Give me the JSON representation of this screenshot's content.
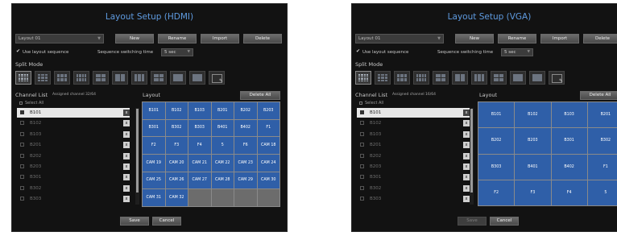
{
  "hdmi": {
    "title": "Layout Setup (HDMI)",
    "layout_select": "Layout 01",
    "buttons": {
      "new": "New",
      "rename": "Rename",
      "import": "Import",
      "delete": "Delete"
    },
    "use_sequence_label": "Use layout sequence",
    "switching_time_label": "Sequence switching time",
    "switching_time_value": "5 sec",
    "split_mode_label": "Split Mode",
    "channel_list_label": "Channel List",
    "assigned_label": "Assigned channel",
    "assigned_count": "32/64",
    "select_all_label": "Select All",
    "layout_label": "Layout",
    "delete_all": "Delete All",
    "channels": [
      "B101",
      "B102",
      "B103",
      "B201",
      "B202",
      "B203",
      "B301",
      "B302",
      "B303"
    ],
    "selected_channel_index": 0,
    "remove_glyph": "x",
    "scroll_position": 0.05,
    "grid": [
      "B101",
      "B102",
      "B103",
      "B201",
      "B202",
      "B203",
      "B301",
      "B302",
      "B303",
      "B401",
      "B402",
      "F1",
      "F2",
      "F3",
      "F4",
      "5",
      "F6",
      "CAM 18",
      "CAM 19",
      "CAM 20",
      "CAM 21",
      "CAM 22",
      "CAM 23",
      "CAM 24",
      "CAM 25",
      "CAM 26",
      "CAM 27",
      "CAM 28",
      "CAM 29",
      "CAM 30",
      "CAM 31",
      "CAM 32",
      "",
      "",
      "",
      ""
    ],
    "save": "Save",
    "cancel": "Cancel"
  },
  "vga": {
    "title": "Layout Setup (VGA)",
    "layout_select": "Layout 01",
    "buttons": {
      "new": "New",
      "rename": "Rename",
      "import": "Import",
      "delete": "Delete"
    },
    "use_sequence_label": "Use layout sequence",
    "switching_time_label": "Sequence switching time",
    "switching_time_value": "5 sec",
    "split_mode_label": "Split Mode",
    "channel_list_label": "Channel List",
    "assigned_label": "Assigned channel",
    "assigned_count": "16/64",
    "select_all_label": "Select All",
    "layout_label": "Layout",
    "delete_all": "Delete All",
    "channels": [
      "B101",
      "B102",
      "B103",
      "B201",
      "B202",
      "B203",
      "B301",
      "B302",
      "B303"
    ],
    "selected_channel_index": 0,
    "remove_glyph": "x",
    "scroll_position": 0.05,
    "grid": [
      "B101",
      "B102",
      "B103",
      "B201",
      "B202",
      "B203",
      "B301",
      "B302",
      "B303",
      "B401",
      "B402",
      "F1",
      "F2",
      "F3",
      "F4",
      "5"
    ],
    "save": "Save",
    "cancel": "Cancel"
  },
  "colors": {
    "title": "#5f9be0",
    "panel": "#121212",
    "cell": "#2f5fa8",
    "cell_empty": "#6c6c6c"
  }
}
